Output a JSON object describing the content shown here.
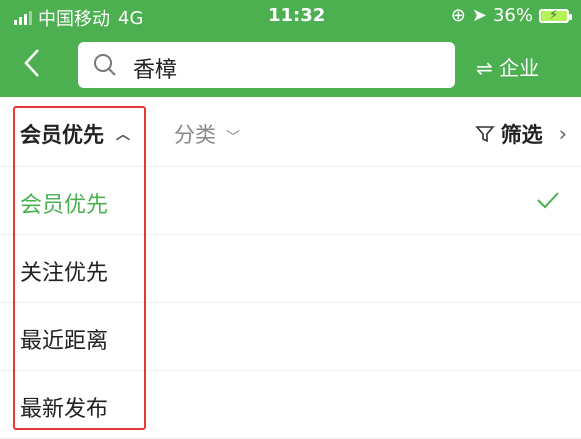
{
  "status": {
    "carrier": "中国移动",
    "network": "4G",
    "time": "11:32",
    "battery": "36%"
  },
  "search": {
    "query": "香樟"
  },
  "header": {
    "switch_label": "⇌ 企业"
  },
  "filters": {
    "sort_label": "会员优先",
    "category_label": "分类",
    "filter_label": "筛选"
  },
  "sort_options": [
    {
      "label": "会员优先",
      "selected": true
    },
    {
      "label": "关注优先",
      "selected": false
    },
    {
      "label": "最近距离",
      "selected": false
    },
    {
      "label": "最新发布",
      "selected": false
    }
  ],
  "colors": {
    "brand": "#4caf50",
    "highlight": "#e53935"
  },
  "icons": [
    "back-arrow-icon",
    "search-icon",
    "switch-icon",
    "chevron-up-icon",
    "chevron-down-icon",
    "filter-icon",
    "chevron-right-icon",
    "checkmark-icon"
  ]
}
